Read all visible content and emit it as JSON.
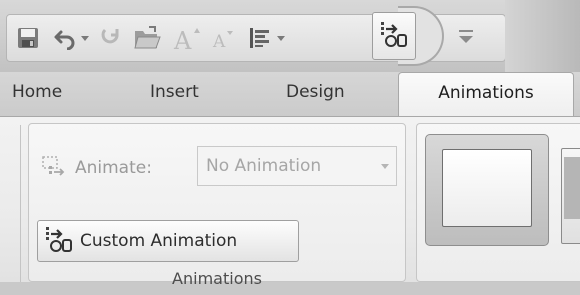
{
  "quick_access_toolbar": {
    "icons": [
      "save-icon",
      "undo-icon",
      "redo-icon",
      "open-icon",
      "grow-font-icon",
      "shrink-font-icon",
      "align-text-icon",
      "custom-animation-icon",
      "customize-toolbar-icon"
    ]
  },
  "tabs": [
    {
      "label": "Home"
    },
    {
      "label": "Insert"
    },
    {
      "label": "Design"
    },
    {
      "label": "Animations",
      "active": true
    }
  ],
  "animations_group": {
    "animate_label": "Animate:",
    "animate_value": "No Animation",
    "custom_animation_label": "Custom Animation",
    "group_label": "Animations"
  },
  "transition_group": {
    "thumbnail_icon": "no-transition-thumbnail"
  },
  "colors": {
    "disabled_text": "#9a9a9a",
    "active_tab": "#fafafa",
    "ribbon": "#ebebeb"
  }
}
